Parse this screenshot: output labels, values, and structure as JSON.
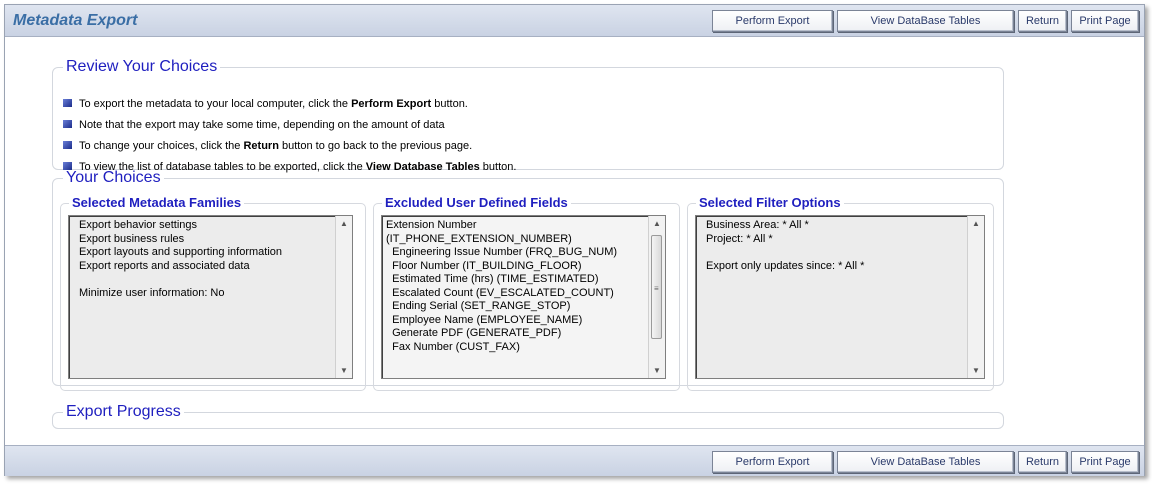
{
  "header": {
    "title": "Metadata Export",
    "buttons": {
      "perform_export": "Perform Export",
      "view_tables": "View DataBase Tables",
      "return": "Return",
      "print_page": "Print Page"
    }
  },
  "review": {
    "legend": "Review Your Choices",
    "items": [
      {
        "before": "To export the metadata to your local computer, click the ",
        "bold": "Perform Export",
        "after": " button."
      },
      {
        "before": "Note that the export may take some time, depending on the amount of data",
        "bold": "",
        "after": ""
      },
      {
        "before": "To change your choices, click the ",
        "bold": "Return",
        "after": " button to go back to the previous page."
      },
      {
        "before": "To view the list of database tables to be exported, click the ",
        "bold": "View Database Tables",
        "after": " button."
      }
    ]
  },
  "choices": {
    "legend": "Your Choices",
    "families": {
      "title": "Selected Metadata Families",
      "lines": "Export behavior settings\nExport business rules\nExport layouts and supporting information\nExport reports and associated data\n\nMinimize user information: No"
    },
    "excluded": {
      "title": "Excluded User Defined Fields",
      "lines": "Extension Number\n(IT_PHONE_EXTENSION_NUMBER)\n  Engineering Issue Number (FRQ_BUG_NUM)\n  Floor Number (IT_BUILDING_FLOOR)\n  Estimated Time (hrs) (TIME_ESTIMATED)\n  Escalated Count (EV_ESCALATED_COUNT)\n  Ending Serial (SET_RANGE_STOP)\n  Employee Name (EMPLOYEE_NAME)\n  Generate PDF (GENERATE_PDF)\n  Fax Number (CUST_FAX)"
    },
    "filters": {
      "title": "Selected Filter Options",
      "lines": "Business Area: * All *\nProject: * All *\n\nExport only updates since: * All *"
    }
  },
  "progress": {
    "legend": "Export Progress"
  },
  "footer": {
    "buttons": {
      "perform_export": "Perform Export",
      "view_tables": "View DataBase Tables",
      "return": "Return",
      "print_page": "Print Page"
    }
  }
}
